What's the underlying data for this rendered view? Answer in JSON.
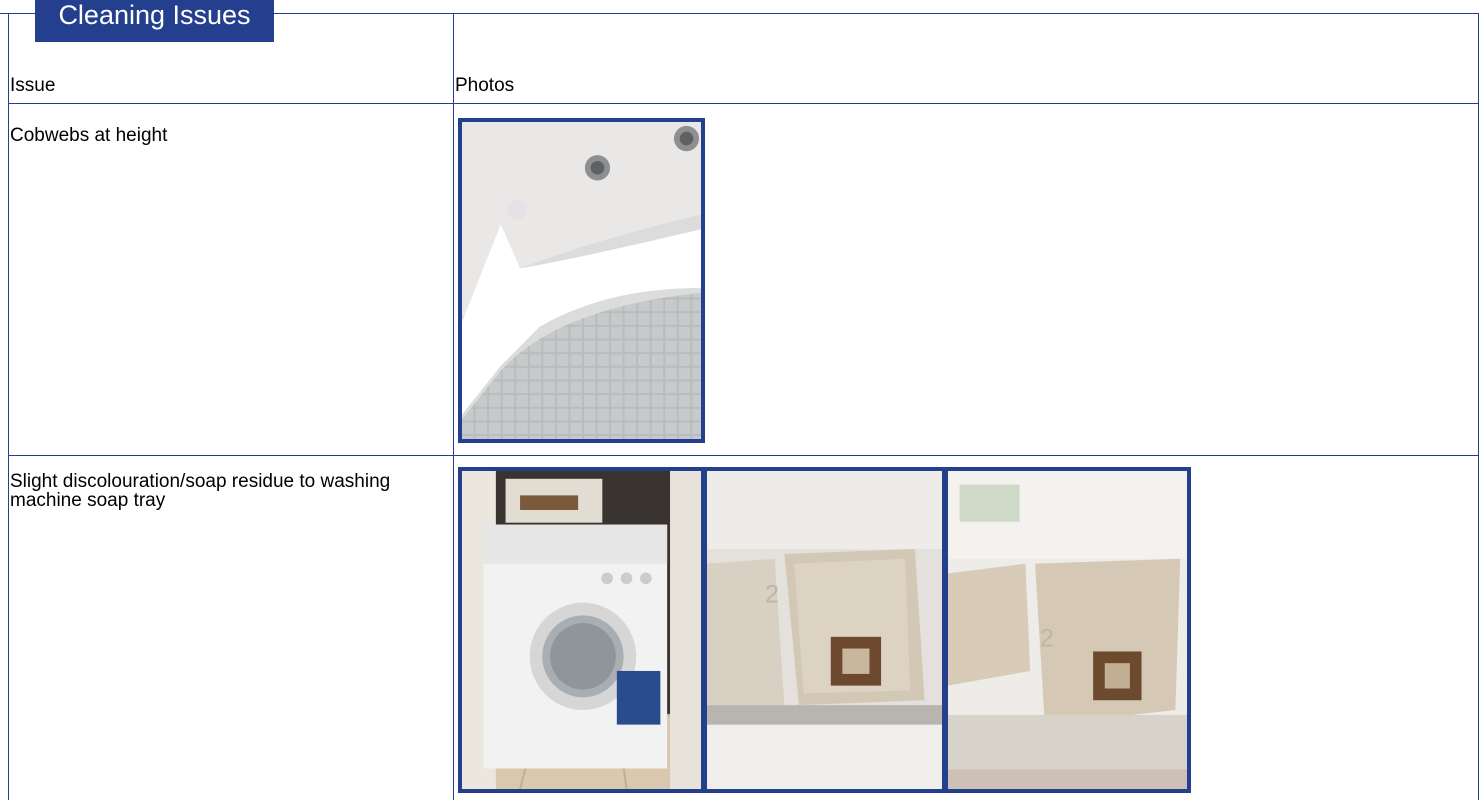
{
  "section": {
    "title": "Cleaning Issues"
  },
  "table": {
    "headers": {
      "issue": "Issue",
      "photos": "Photos"
    },
    "rows": [
      {
        "issue": "Cobwebs at height",
        "photos": [
          "ceiling-cobwebs-photo"
        ]
      },
      {
        "issue": "Slight discolouration/soap residue to washing machine soap tray",
        "photos": [
          "washing-machine-photo",
          "soap-tray-photo",
          "soap-tray-closeup-photo"
        ]
      }
    ]
  },
  "colors": {
    "accent": "#233f8e",
    "background": "#ffffff"
  }
}
